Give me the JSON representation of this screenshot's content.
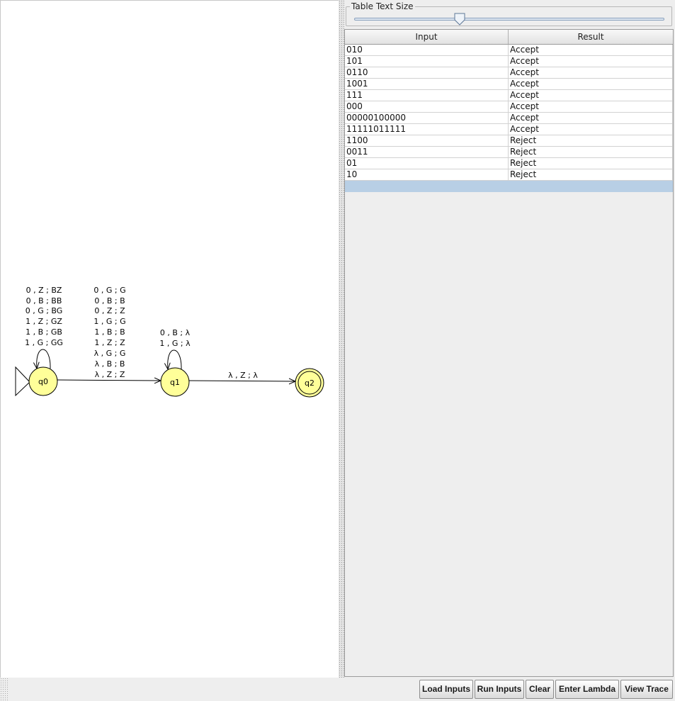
{
  "slider": {
    "title": "Table Text Size",
    "value_fraction": 0.34
  },
  "automaton": {
    "states": [
      {
        "name": "q0",
        "initial": true,
        "final": false
      },
      {
        "name": "q1",
        "initial": false,
        "final": false
      },
      {
        "name": "q2",
        "initial": false,
        "final": true
      }
    ],
    "transitions": {
      "q0_loop": [
        "0 , Z ; BZ",
        "0 , B ; BB",
        "0 , G ; BG",
        "1 , Z ; GZ",
        "1 , B ; GB",
        "1 , G ; GG"
      ],
      "q0_to_q1": [
        "0 , G ; G",
        "0 , B ; B",
        "0 , Z ; Z",
        "1 , G ; G",
        "1 , B ; B",
        "1 , Z ; Z",
        "λ , G ; G",
        "λ , B ; B",
        "λ , Z ; Z"
      ],
      "q1_loop": [
        "0 , B ; λ",
        "1 , G ; λ"
      ],
      "q1_to_q2": [
        "λ , Z ; λ"
      ]
    },
    "colors": {
      "state_fill": "#ffff99",
      "state_stroke": "#000000"
    }
  },
  "table": {
    "headers": [
      "Input",
      "Result"
    ],
    "rows": [
      {
        "input": "010",
        "result": "Accept"
      },
      {
        "input": "101",
        "result": "Accept"
      },
      {
        "input": "0110",
        "result": "Accept"
      },
      {
        "input": "1001",
        "result": "Accept"
      },
      {
        "input": "111",
        "result": "Accept"
      },
      {
        "input": "000",
        "result": "Accept"
      },
      {
        "input": "00000100000",
        "result": "Accept"
      },
      {
        "input": "11111011111",
        "result": "Accept"
      },
      {
        "input": "1100",
        "result": "Reject"
      },
      {
        "input": "0011",
        "result": "Reject"
      },
      {
        "input": "01",
        "result": "Reject"
      },
      {
        "input": "10",
        "result": "Reject"
      },
      {
        "input": "",
        "result": ""
      }
    ],
    "selected_row": 12
  },
  "buttons": {
    "load": "Load Inputs",
    "run": "Run Inputs",
    "clear": "Clear",
    "lambda": "Enter Lambda",
    "trace": "View Trace"
  }
}
